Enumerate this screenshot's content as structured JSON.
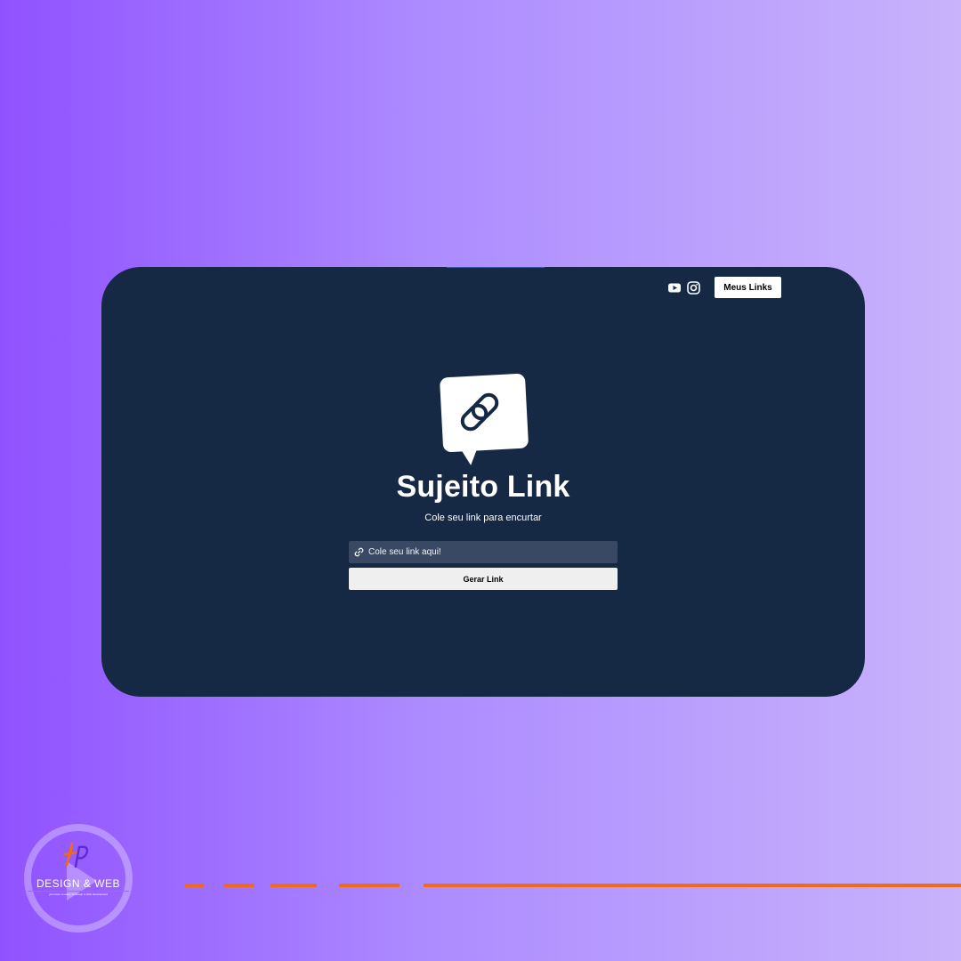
{
  "colors": {
    "background_start": "#9052ff",
    "background_end": "#c9b3fb",
    "card": "#152844",
    "input_bg": "#3a4963",
    "button_bg": "#efefef",
    "accent_orange": "#f36a16"
  },
  "header": {
    "icons": [
      "youtube-icon",
      "instagram-icon"
    ],
    "my_links_label": "Meus Links"
  },
  "hero": {
    "logo_icon": "link-chat-bubble-icon",
    "title": "Sujeito Link",
    "subtitle": "Cole seu link para encurtar"
  },
  "form": {
    "input_icon": "link-icon",
    "placeholder": "Cole seu link aqui!",
    "value": "",
    "submit_label": "Gerar Link"
  },
  "brand": {
    "text": "DESIGN & WEB",
    "tagline": "your best on every UI design & Web development",
    "icon": "play-icon"
  }
}
